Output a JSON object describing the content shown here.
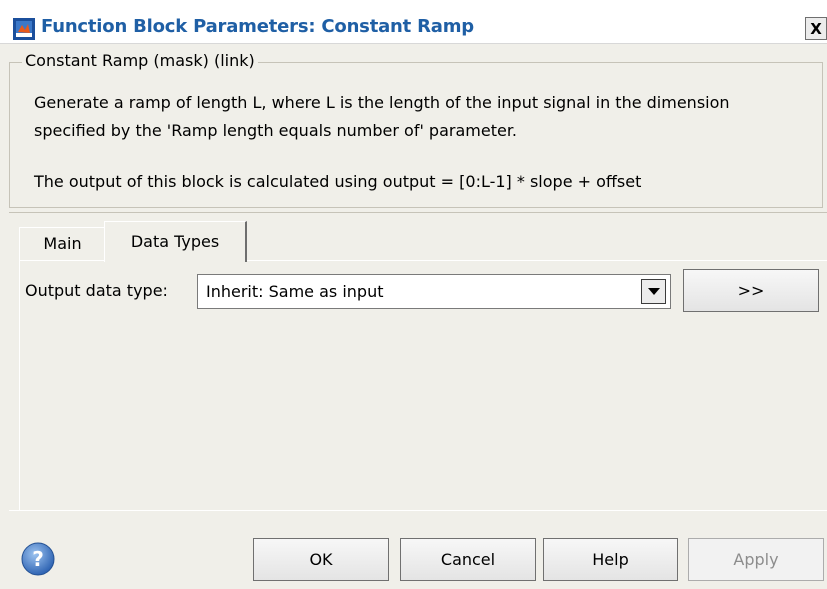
{
  "window": {
    "title": "Function Block Parameters: Constant Ramp",
    "close_label": "X"
  },
  "group": {
    "legend": "Constant Ramp (mask) (link)",
    "description_lines": [
      "Generate a ramp of length L, where L is the length of the input signal in the dimension",
      "specified by the 'Ramp length equals number of' parameter.",
      "The output of this block is calculated using output = [0:L-1] * slope + offset"
    ]
  },
  "tabs": [
    {
      "label": "Main",
      "active": false
    },
    {
      "label": "Data Types",
      "active": true
    }
  ],
  "data_types": {
    "output_label": "Output data type:",
    "output_value": "Inherit: Same as input",
    "more_label": ">>"
  },
  "footer": {
    "help_icon": "question-icon",
    "ok_label": "OK",
    "cancel_label": "Cancel",
    "help_label": "Help",
    "apply_label": "Apply",
    "apply_enabled": false
  }
}
